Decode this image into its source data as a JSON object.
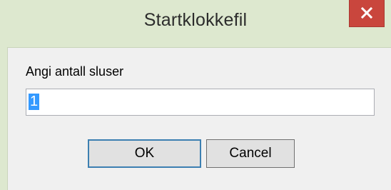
{
  "window": {
    "title": "Startklokkefil",
    "close_icon": "close-icon"
  },
  "form": {
    "prompt_label": "Angi antall sluser",
    "input_value": "1"
  },
  "buttons": {
    "ok_label": "OK",
    "cancel_label": "Cancel"
  },
  "colors": {
    "titlebar": "#dde8cf",
    "close_button": "#c9463d",
    "selection": "#3399ff",
    "default_button_border": "#3c7fb1"
  }
}
